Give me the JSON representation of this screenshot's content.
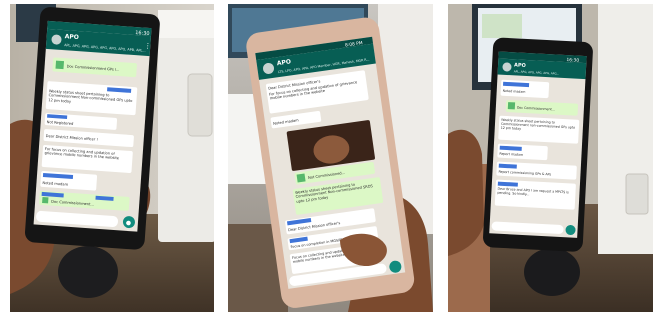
{
  "panels": [
    {
      "status_time": "16:30",
      "chat_title": "APO",
      "chat_members": "APL, APG, APG, APG, APG, APG, APO, APB, APL...",
      "messages": [
        "Doc Commissionment GPs l...",
        "Weekly status sheet pertaining to Commissionment Non-commissioned GPs upto 12 pm today",
        "Not Registered",
        "Dear District Mission officer !",
        "For focus on collecting and updation of grievance mobile numbers in the website",
        "Noted madam",
        "Doc Commissionment..."
      ]
    },
    {
      "status_time": "8:08 PM",
      "chat_title": "APO",
      "chat_members": "LTS, LPO, APO, APA, APO Member, HGR, Mahesh, MGR R...",
      "messages": [
        "Dear District Mission officer's",
        "For focus on collecting and updation of grievance mobile numbers in the website",
        "Noted madam",
        "Not Commissioned...",
        "Weekly status sheet pertaining to Commissionment Non-commissioned SROS upto 12 pm today",
        "Dear District Mission officer's",
        "Focus on completion in MGS/PMGSY works",
        "Focus on collecting and updation of grievance mobile numbers in the website"
      ]
    },
    {
      "status_time": "16:30",
      "chat_title": "APO",
      "chat_members": "APL, APG, APG, APG, APG, APG...",
      "messages": [
        "Noted madam",
        "Doc Commissionment...",
        "Weekly status sheet pertaining to Commissionment non-commissioned GPs upto 12 pm today",
        "Report madam",
        "Report commissioning GPs & APs",
        "Dear Bruce and APO I am request a MPLTS is pending. So kindly..."
      ]
    }
  ]
}
